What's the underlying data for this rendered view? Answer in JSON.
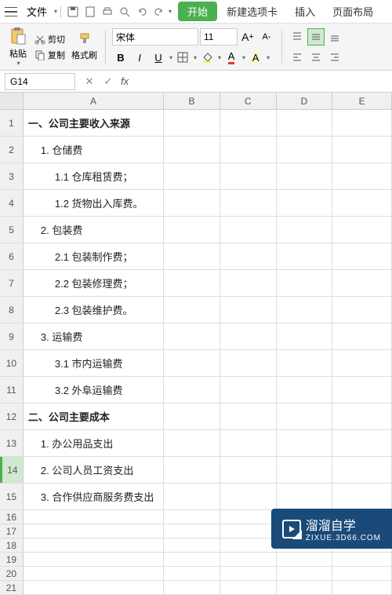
{
  "menubar": {
    "file": "文件",
    "tabs": [
      "开始",
      "新建选项卡",
      "插入",
      "页面布局"
    ]
  },
  "ribbon": {
    "paste": "粘贴",
    "cut": "剪切",
    "copy": "复制",
    "format_painter": "格式刷",
    "font_name": "宋体",
    "font_size": "11",
    "bold": "B",
    "italic": "I",
    "underline": "U",
    "font_grow": "A",
    "font_shrink": "A",
    "font_color": "A",
    "highlight": "A"
  },
  "formula_bar": {
    "cell_ref": "G14",
    "fx": "fx"
  },
  "columns": [
    "A",
    "B",
    "C",
    "D",
    "E"
  ],
  "rows": [
    {
      "num": "1",
      "a": "一、公司主要收入来源",
      "bold": true,
      "tall": true
    },
    {
      "num": "2",
      "a": "1. 仓储费",
      "indent": 1,
      "tall": true
    },
    {
      "num": "3",
      "a": "1.1 仓库租赁费；",
      "indent": 2,
      "tall": true
    },
    {
      "num": "4",
      "a": "1.2 货物出入库费。",
      "indent": 2,
      "tall": true
    },
    {
      "num": "5",
      "a": "2. 包装费",
      "indent": 1,
      "tall": true
    },
    {
      "num": "6",
      "a": "2.1 包装制作费；",
      "indent": 2,
      "tall": true
    },
    {
      "num": "7",
      "a": "2.2 包装修理费；",
      "indent": 2,
      "tall": true
    },
    {
      "num": "8",
      "a": "2.3 包装维护费。",
      "indent": 2,
      "tall": true
    },
    {
      "num": "9",
      "a": "3. 运输费",
      "indent": 1,
      "tall": true
    },
    {
      "num": "10",
      "a": "3.1 市内运输费",
      "indent": 2,
      "tall": true
    },
    {
      "num": "11",
      "a": "3.2 外阜运输费",
      "indent": 2,
      "tall": true
    },
    {
      "num": "12",
      "a": "二、公司主要成本",
      "bold": true,
      "tall": true
    },
    {
      "num": "13",
      "a": "1. 办公用品支出",
      "indent": 1,
      "tall": true
    },
    {
      "num": "14",
      "a": "2. 公司人员工资支出",
      "indent": 1,
      "tall": true,
      "selected": true
    },
    {
      "num": "15",
      "a": "3. 合作供应商服务费支出",
      "indent": 1,
      "tall": true
    },
    {
      "num": "16",
      "a": "",
      "tall": false
    },
    {
      "num": "17",
      "a": "",
      "tall": false
    },
    {
      "num": "18",
      "a": "",
      "tall": false
    },
    {
      "num": "19",
      "a": "",
      "tall": false
    },
    {
      "num": "20",
      "a": "",
      "tall": false
    },
    {
      "num": "21",
      "a": "",
      "tall": false
    }
  ],
  "watermark": {
    "text": "溜溜自学",
    "sub": "ZIXUE.3D66.COM"
  }
}
